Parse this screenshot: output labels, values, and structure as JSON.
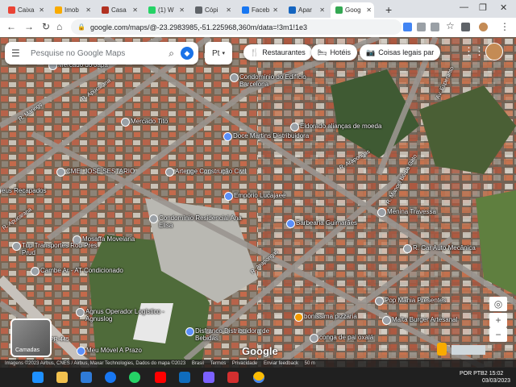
{
  "tabs": [
    {
      "label": "Caixa",
      "color": "#ea4335"
    },
    {
      "label": "Imob",
      "color": "#f9ab00"
    },
    {
      "label": "Casa",
      "color": "#b23121"
    },
    {
      "label": "(1) W",
      "color": "#25d366"
    },
    {
      "label": "Cópi",
      "color": "#5f6368"
    },
    {
      "label": "Faceb",
      "color": "#1877f2"
    },
    {
      "label": "Apar",
      "color": "#1565c0"
    },
    {
      "label": "Goog",
      "color": "#34a853",
      "active": true
    }
  ],
  "url": "google.com/maps/@-23.2983985,-51.225968,360m/data=!3m1!1e3",
  "search": {
    "placeholder": "Pesquise no Google Maps"
  },
  "pt_button": "Pt",
  "chips": [
    "Restaurantes",
    "Hotéis",
    "Coisas legais par"
  ],
  "layers_label": "Camadas",
  "google_logo": "Google",
  "footer": {
    "imagery": "Imagens ©2023 Airbus, CNES / Airbus, Maxar Technologies, Dados do mapa ©2023",
    "brasil": "Brasil",
    "terms": "Termos",
    "privacy": "Privacidade",
    "feedback": "Enviar feedback",
    "scale": "50 m"
  },
  "places": [
    {
      "name": "Mercado do Japa"
    },
    {
      "name": "Condomínio do Edifício Barcelona"
    },
    {
      "name": "Mercado Tito"
    },
    {
      "name": "Doce Martins Distribuidora"
    },
    {
      "name": "Eldorado alianças de moeda"
    },
    {
      "name": "Artenge Construção Civil"
    },
    {
      "name": "CMEI JOSÉ SESTARIO"
    },
    {
      "name": "Empório Lucajaee"
    },
    {
      "name": "Menina Travessa"
    },
    {
      "name": "Condomínio Residencial Ana Elisa"
    },
    {
      "name": "Barbearia Guimarães"
    },
    {
      "name": "Mosaffa Movelaria"
    },
    {
      "name": "R. Car Auto Mecânica"
    },
    {
      "name": "Tup Transportes Rod Pres Prud"
    },
    {
      "name": "Cambe Ar - AT Condicionado"
    },
    {
      "name": "Pop Mania Presentes"
    },
    {
      "name": "Agnus Operador Logístico - Agnuslog"
    },
    {
      "name": "bonissima pizzaria"
    },
    {
      "name": "Malta Burger Artesanal"
    },
    {
      "name": "Disfranco Distribuidora de Bebidas"
    },
    {
      "name": "conga de pai oxalá"
    },
    {
      "name": "Meu Móvel A Prazo"
    },
    {
      "name": "eus Recapados"
    }
  ],
  "streets": [
    {
      "name": "R. Marings"
    },
    {
      "name": "R. Apucarana"
    },
    {
      "name": "R. Apucarana"
    },
    {
      "name": "R. Arapongas"
    },
    {
      "name": "R. Arapongas"
    },
    {
      "name": "R. Manoel Borba Gato"
    },
    {
      "name": "Av. Esperanto"
    },
    {
      "name": "PR-445"
    }
  ],
  "taskbar": {
    "lang": "POR PTB2",
    "time": "15:02",
    "date": "03/03/2023"
  }
}
